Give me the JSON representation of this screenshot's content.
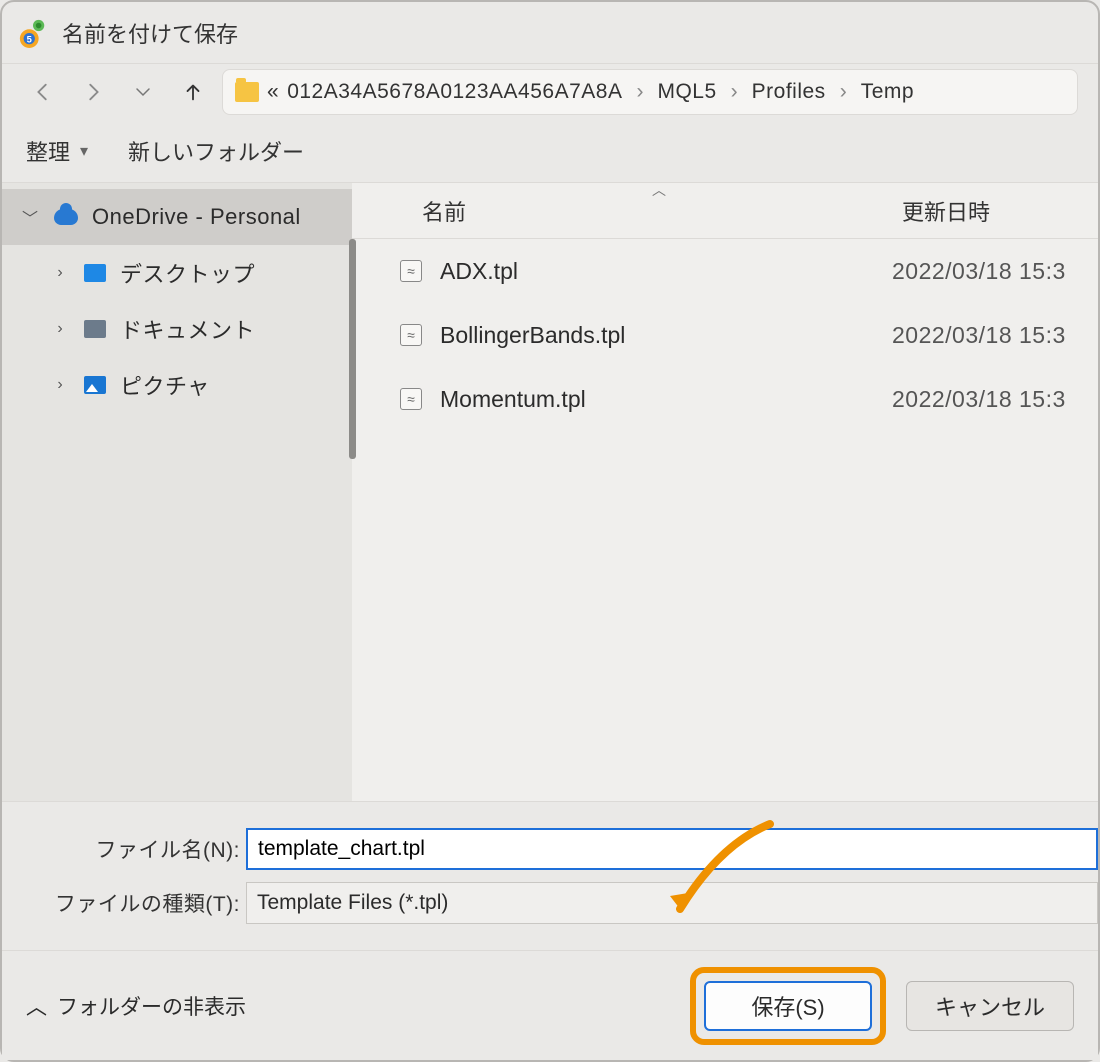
{
  "title": "名前を付けて保存",
  "nav": {
    "back_enabled": false,
    "forward_enabled": false
  },
  "address": {
    "overflow": "«",
    "segments": [
      "012A34A5678A0123AA456A7A8A",
      "MQL5",
      "Profiles",
      "Temp"
    ]
  },
  "toolbar": {
    "organize": "整理",
    "new_folder": "新しいフォルダー"
  },
  "sidebar": {
    "root": {
      "label": "OneDrive - Personal",
      "expanded": true
    },
    "children": [
      {
        "label": "デスクトップ",
        "icon": "desktop"
      },
      {
        "label": "ドキュメント",
        "icon": "doc"
      },
      {
        "label": "ピクチャ",
        "icon": "pic"
      }
    ]
  },
  "columns": {
    "name": "名前",
    "modified": "更新日時"
  },
  "files": [
    {
      "name": "ADX.tpl",
      "modified": "2022/03/18 15:3"
    },
    {
      "name": "BollingerBands.tpl",
      "modified": "2022/03/18 15:3"
    },
    {
      "name": "Momentum.tpl",
      "modified": "2022/03/18 15:3"
    }
  ],
  "fields": {
    "filename_label": "ファイル名(N):",
    "filename_value": "template_chart.tpl",
    "filetype_label": "ファイルの種類(T):",
    "filetype_value": "Template Files (*.tpl)"
  },
  "footer": {
    "hide_folders": "フォルダーの非表示",
    "save": "保存(S)",
    "cancel": "キャンセル"
  }
}
